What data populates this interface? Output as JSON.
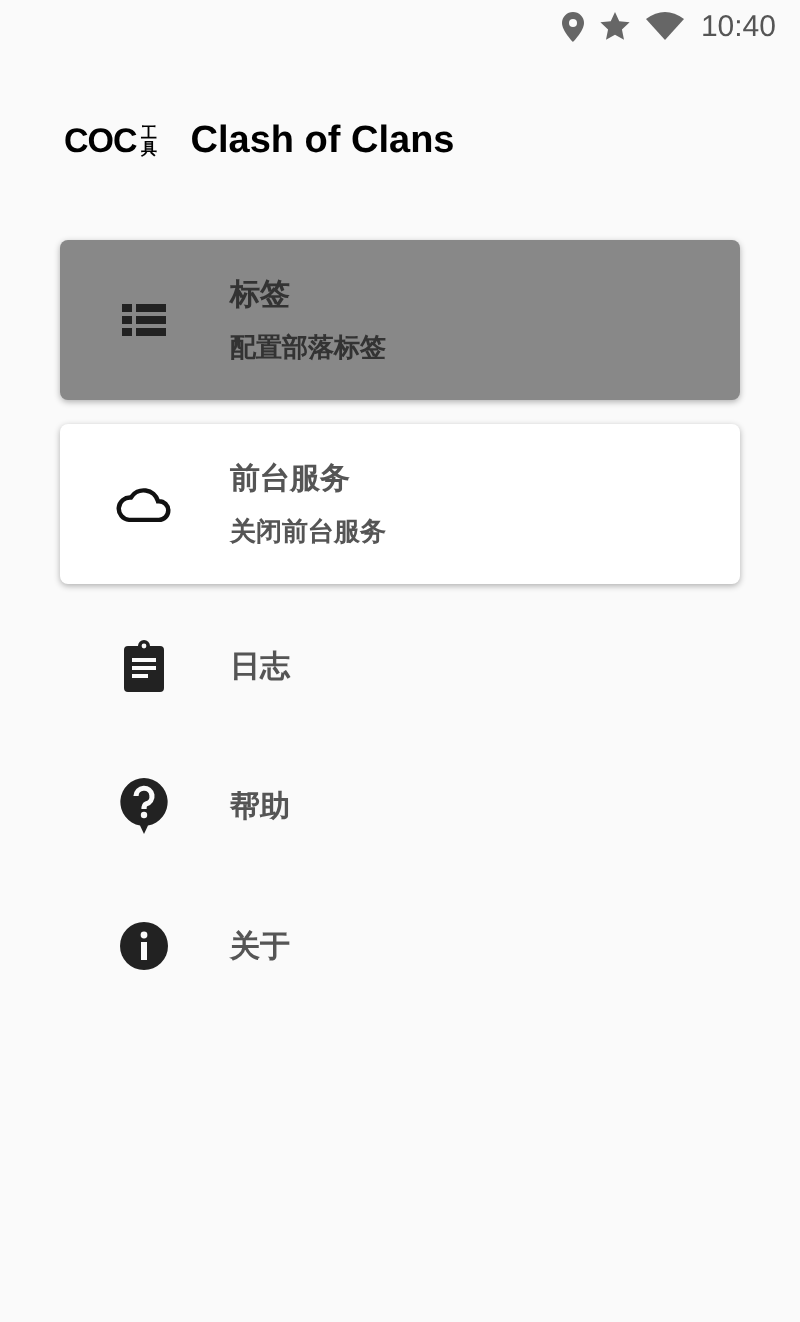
{
  "status_bar": {
    "time": "10:40"
  },
  "header": {
    "logo": "COC",
    "logo_small": "工具",
    "title": "Clash of Clans"
  },
  "menu": [
    {
      "kind": "card",
      "selected": true,
      "title": "标签",
      "subtitle": "配置部落标签"
    },
    {
      "kind": "card",
      "selected": false,
      "title": "前台服务",
      "subtitle": "关闭前台服务"
    },
    {
      "kind": "plain",
      "selected": false,
      "title": "日志"
    },
    {
      "kind": "plain",
      "selected": false,
      "title": "帮助"
    },
    {
      "kind": "plain",
      "selected": false,
      "title": "关于"
    }
  ]
}
